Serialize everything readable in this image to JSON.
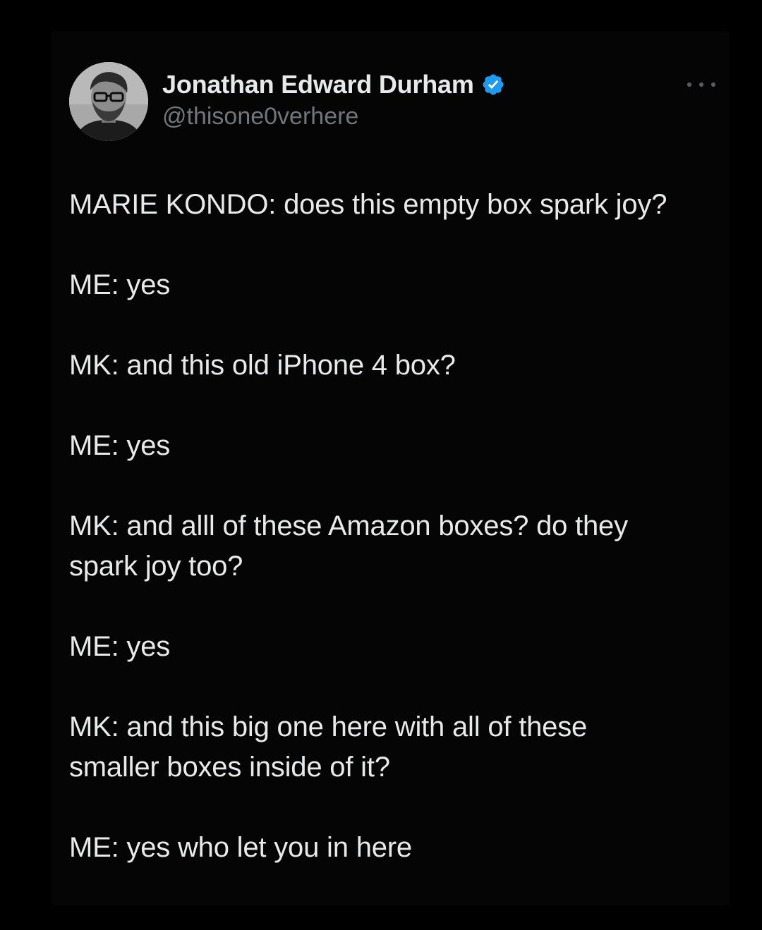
{
  "tweet": {
    "author": {
      "display_name": "Jonathan Edward Durham",
      "handle": "@thisone0verhere",
      "verified": true,
      "avatar_icon": "profile-photo-man-glasses"
    },
    "more_icon": "more-options-icon",
    "lines": [
      "MARIE KONDO: does this empty box spark joy?",
      "ME: yes",
      "MK: and this old iPhone 4 box?",
      "ME: yes",
      "MK: and alll of these Amazon boxes? do they\nspark joy too?",
      "ME: yes",
      "MK: and this big one here with all of these\nsmaller boxes inside of it?",
      "ME: yes who let you in here"
    ]
  },
  "colors": {
    "background": "#000000",
    "text": "#e7e9ea",
    "secondary_text": "#71767b",
    "verified_blue": "#1d9bf0"
  }
}
